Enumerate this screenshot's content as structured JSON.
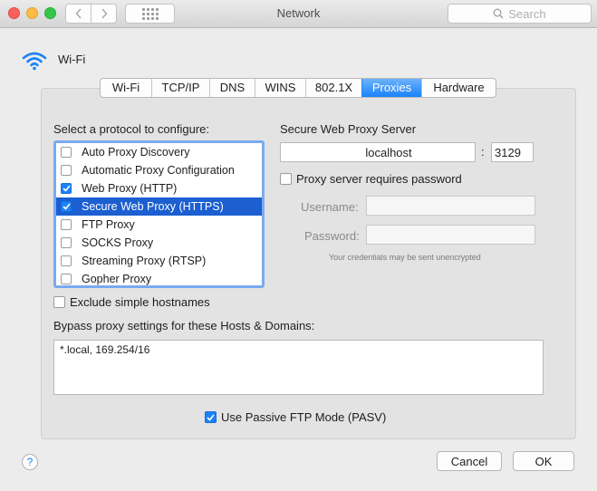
{
  "window": {
    "title": "Network",
    "search_placeholder": "Search"
  },
  "header": {
    "interface_name": "Wi-Fi"
  },
  "tabs": [
    {
      "label": "Wi-Fi"
    },
    {
      "label": "TCP/IP"
    },
    {
      "label": "DNS"
    },
    {
      "label": "WINS"
    },
    {
      "label": "802.1X"
    },
    {
      "label": "Proxies",
      "selected": true
    },
    {
      "label": "Hardware"
    }
  ],
  "protocols": {
    "heading": "Select a protocol to configure:",
    "items": [
      {
        "label": "Auto Proxy Discovery",
        "checked": false
      },
      {
        "label": "Automatic Proxy Configuration",
        "checked": false
      },
      {
        "label": "Web Proxy (HTTP)",
        "checked": true
      },
      {
        "label": "Secure Web Proxy (HTTPS)",
        "checked": true,
        "selected": true
      },
      {
        "label": "FTP Proxy",
        "checked": false
      },
      {
        "label": "SOCKS Proxy",
        "checked": false
      },
      {
        "label": "Streaming Proxy (RTSP)",
        "checked": false
      },
      {
        "label": "Gopher Proxy",
        "checked": false
      }
    ]
  },
  "exclude_simple": {
    "label": "Exclude simple hostnames",
    "checked": false
  },
  "server": {
    "heading": "Secure Web Proxy Server",
    "host": "localhost",
    "separator": ":",
    "port": "3129",
    "requires_password_label": "Proxy server requires password",
    "requires_password": false,
    "username_label": "Username:",
    "username": "",
    "password_label": "Password:",
    "password": "",
    "note": "Your credentials may be sent unencrypted"
  },
  "bypass": {
    "heading": "Bypass proxy settings for these Hosts & Domains:",
    "value": "*.local, 169.254/16"
  },
  "passive_ftp": {
    "label": "Use Passive FTP Mode (PASV)",
    "checked": true
  },
  "footer": {
    "help": "?",
    "cancel": "Cancel",
    "ok": "OK"
  },
  "colors": {
    "accent": "#1a82fb",
    "selection": "#1b5fd1"
  }
}
